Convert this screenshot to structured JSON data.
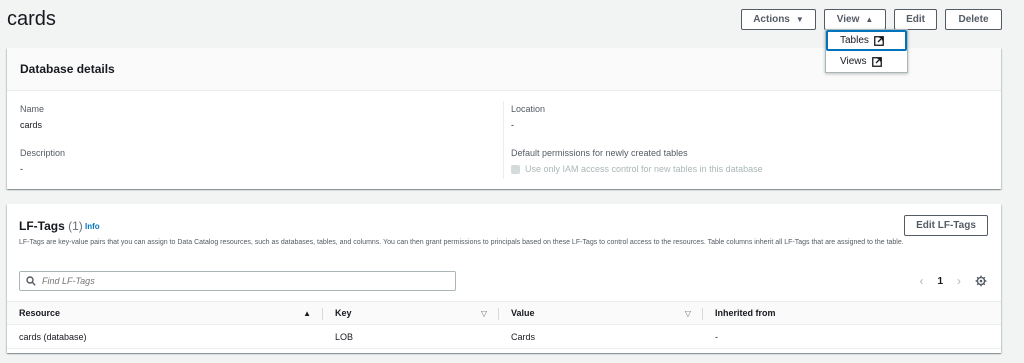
{
  "page": {
    "title": "cards"
  },
  "header_actions": {
    "actions_label": "Actions",
    "view_label": "View",
    "edit_label": "Edit",
    "delete_label": "Delete"
  },
  "view_menu": {
    "items": [
      {
        "label": "Tables"
      },
      {
        "label": "Views"
      }
    ]
  },
  "database_details": {
    "title": "Database details",
    "name_label": "Name",
    "name_value": "cards",
    "description_label": "Description",
    "description_value": "-",
    "location_label": "Location",
    "location_value": "-",
    "default_permissions_label": "Default permissions for newly created tables",
    "iam_checkbox_label": "Use only IAM access control for new tables in this database"
  },
  "lf_tags": {
    "title": "LF-Tags",
    "count": "(1)",
    "info": "Info",
    "edit_button": "Edit LF-Tags",
    "description": "LF-Tags are key-value pairs that you can assign to Data Catalog resources, such as databases, tables, and columns. You can then grant permissions to principals based on these LF-Tags to control access to the resources. Table columns inherit all LF-Tags that are assigned to the table.",
    "search_placeholder": "Find LF-Tags",
    "pagination": {
      "current_page": "1"
    },
    "columns": [
      "Resource",
      "Key",
      "Value",
      "Inherited from"
    ],
    "rows": [
      {
        "resource": "cards (database)",
        "key": "LOB",
        "value": "Cards",
        "inherited_from": "-"
      }
    ]
  }
}
